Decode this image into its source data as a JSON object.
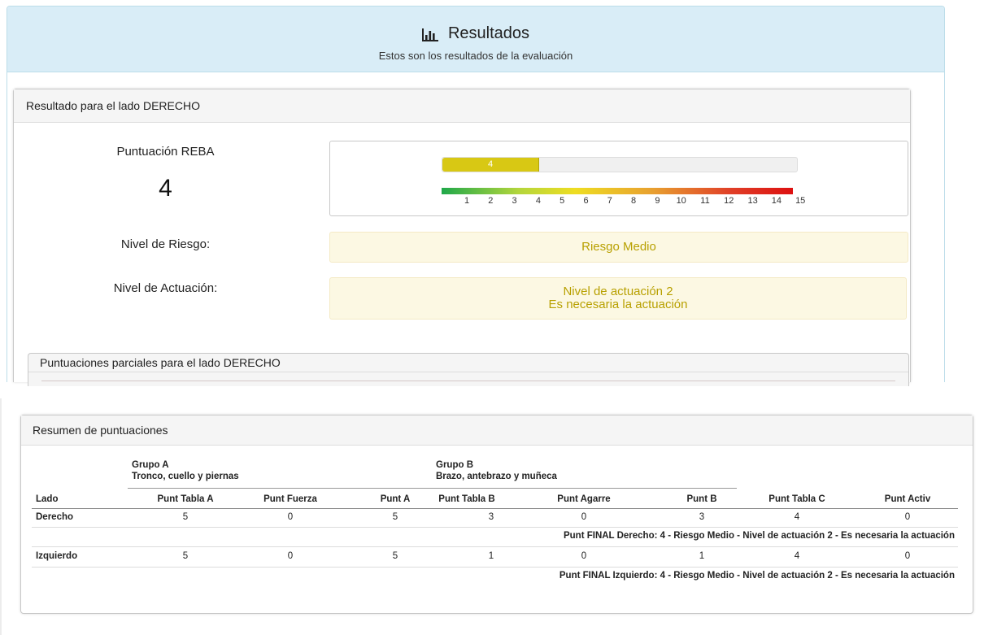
{
  "header": {
    "title": "Resultados",
    "subtitle": "Estos son los resultados de la evaluación"
  },
  "right_side": {
    "panel_title": "Resultado para el lado DERECHO",
    "score_label": "Puntuación REBA",
    "score_value": "4",
    "bar_value_label": "4",
    "bar_fraction": 0.27,
    "scale_ticks": [
      "1",
      "2",
      "3",
      "4",
      "5",
      "6",
      "7",
      "8",
      "9",
      "10",
      "11",
      "12",
      "13",
      "14",
      "15"
    ],
    "risk_label": "Nivel de Riesgo:",
    "risk_value": "Riesgo Medio",
    "action_label": "Nivel de Actuación:",
    "action_value_line1": "Nivel de actuación 2",
    "action_value_line2": "Es necesaria la actuación",
    "partial_title": "Puntuaciones parciales para el lado DERECHO"
  },
  "summary": {
    "title": "Resumen de puntuaciones",
    "group_a_line1": "Grupo A",
    "group_a_line2": "Tronco, cuello y piernas",
    "group_b_line1": "Grupo B",
    "group_b_line2": "Brazo, antebrazo y muñeca",
    "columns": [
      "Lado",
      "Punt Tabla A",
      "Punt Fuerza",
      "Punt A",
      "Punt Tabla B",
      "Punt Agarre",
      "Punt B",
      "Punt Tabla C",
      "Punt Activ"
    ],
    "rows": [
      {
        "lado": "Derecho",
        "values": [
          "5",
          "0",
          "5",
          "3",
          "0",
          "3",
          "4",
          "0"
        ],
        "final": "Punt FINAL Derecho:  4 - Riesgo Medio - Nivel de actuación 2 - Es necesaria la actuación"
      },
      {
        "lado": "Izquierdo",
        "values": [
          "5",
          "0",
          "5",
          "1",
          "0",
          "1",
          "4",
          "0"
        ],
        "final": "Punt FINAL Izquierdo:  4 - Riesgo Medio - Nivel de actuación 2 - Es necesaria la actuación"
      }
    ]
  },
  "colors": {
    "header_bg": "#d9edf7",
    "bar_fill": "#d8c814",
    "warning_bg": "#fcf8e3",
    "warning_text": "#b8a000"
  },
  "icons": {
    "title_icon": "bar-chart-icon"
  }
}
